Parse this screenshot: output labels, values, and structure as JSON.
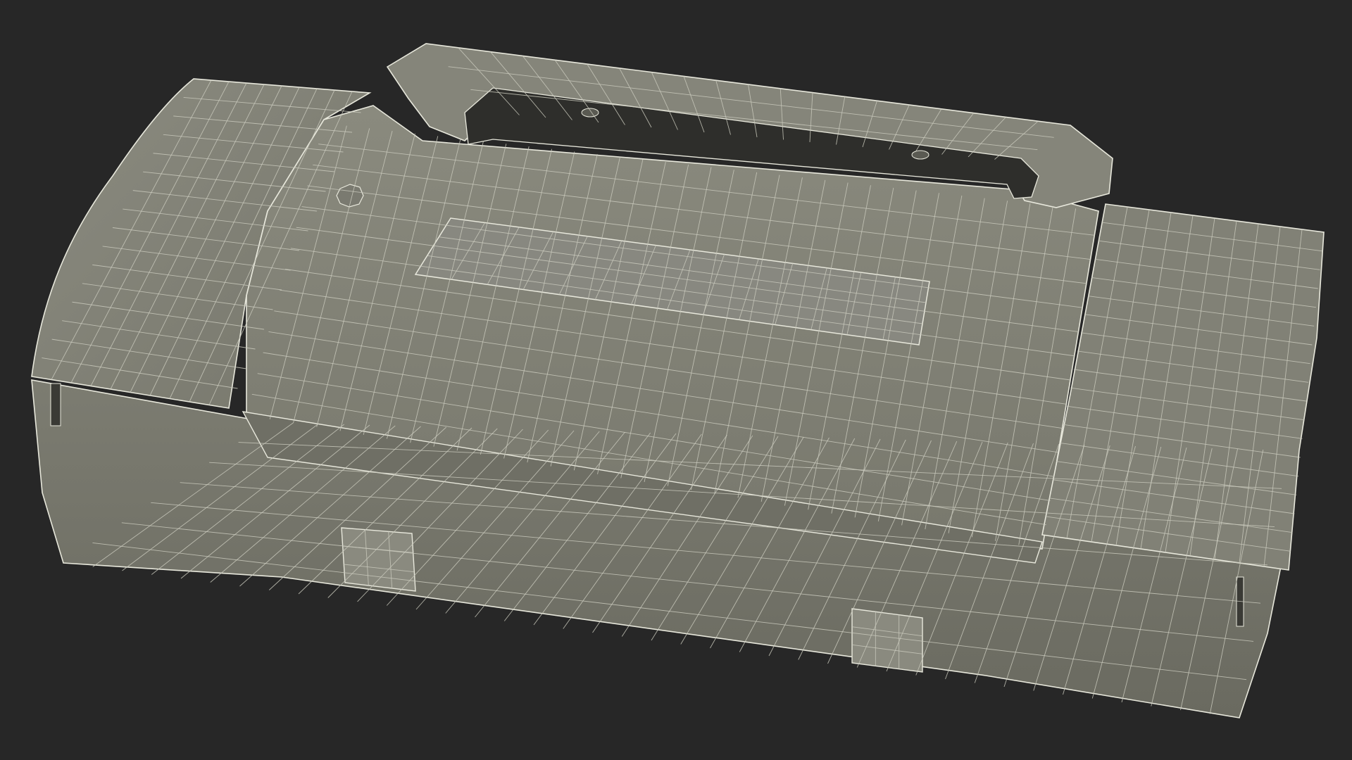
{
  "scene": {
    "subject": "toolbox",
    "render_style": "wireframe",
    "colors": {
      "background": "#272727",
      "surface_light": "#8c8c80",
      "surface_mid": "#7b7b70",
      "surface_dark": "#66665c",
      "surface_shadow": "#55554c",
      "cavity": "#2e2e2b",
      "edge_wire": "#e8e8dc",
      "fine_wire": "#c9c9bc"
    }
  }
}
